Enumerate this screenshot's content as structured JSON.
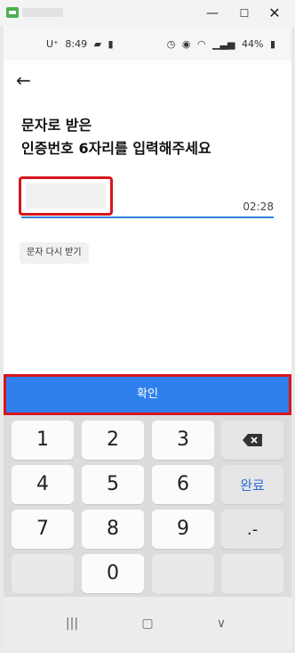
{
  "statusbar": {
    "carrier": "U⁺",
    "time": "8:49",
    "battery": "44%"
  },
  "page": {
    "title_line1": "문자로 받은",
    "title_line2": "인증번호 6자리를 입력해주세요"
  },
  "code_input": {
    "value": "",
    "timer": "02:28"
  },
  "resend_button": "문자 다시 받기",
  "confirm_button": "확인",
  "keyboard": {
    "rows": [
      [
        "1",
        "2",
        "3",
        "backspace"
      ],
      [
        "4",
        "5",
        "6",
        "완료"
      ],
      [
        "7",
        "8",
        "9",
        ".-"
      ],
      [
        "",
        "0",
        "",
        ""
      ]
    ],
    "done_label": "완료",
    "punct_label": ".-"
  },
  "icons": {
    "back": "back-arrow-icon",
    "backspace": "backspace-icon",
    "nav_recent": "recent-apps-icon",
    "nav_home": "home-icon",
    "nav_back": "nav-back-icon"
  },
  "colors": {
    "accent": "#2f80ed",
    "highlight": "#d8141d",
    "keyboard_bg": "#dcdcdc"
  }
}
